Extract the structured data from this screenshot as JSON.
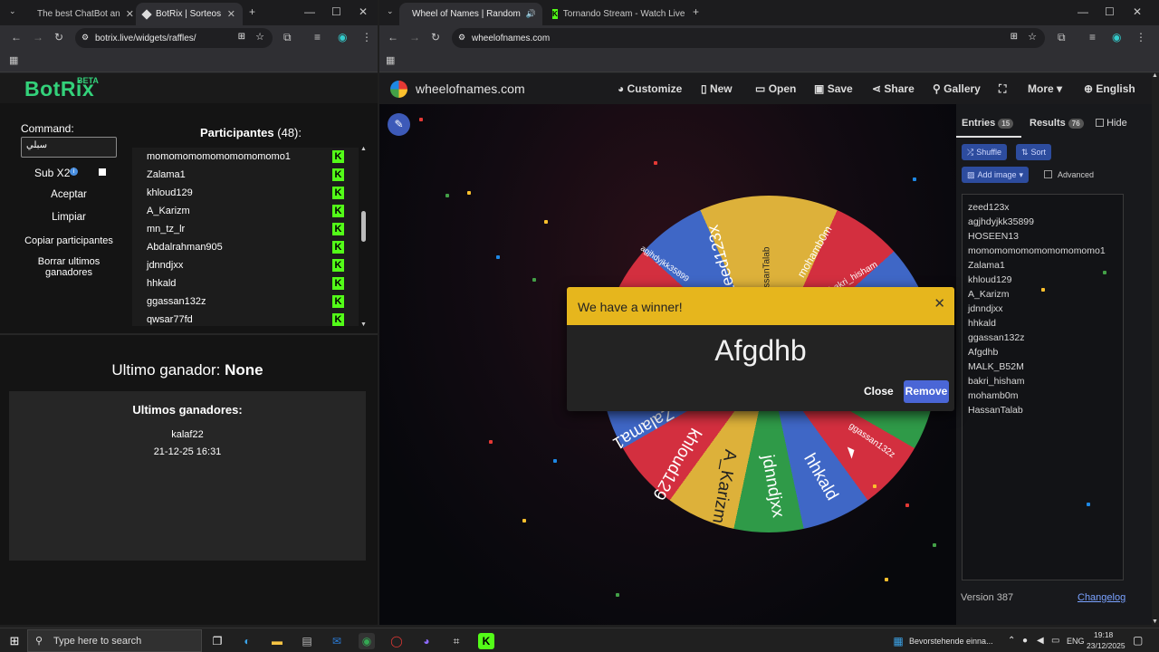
{
  "left_window": {
    "tabs": [
      {
        "label": "The best ChatBot an",
        "active": false
      },
      {
        "label": "BotRix | Sorteos",
        "active": true
      }
    ],
    "url": "botrix.live/widgets/raffles/",
    "app": {
      "logo": "BotRix",
      "beta": "BETA",
      "command_label": "Command:",
      "command_value": "سبلي",
      "sub_x2": "Sub X2",
      "buttons": [
        "Aceptar",
        "Limpiar",
        "Copiar participantes",
        "Borrar ultimos ganadores"
      ],
      "participants_title": "Participantes",
      "participants_count": "(48):",
      "participants": [
        "momomomomomomomomomo1",
        "Zalama1",
        "khloud129",
        "A_Karizm",
        "mn_tz_lr",
        "Abdalrahman905",
        "jdnndjxx",
        "hhkald",
        "ggassan132z",
        "qwsar77fd"
      ],
      "last_winner_label": "Ultimo ganador:",
      "last_winner_value": "None",
      "winners_title": "Ultimos ganadores:",
      "winners": [
        {
          "name": "kalaf22",
          "date": "21-12-25 16:31"
        }
      ]
    }
  },
  "right_window": {
    "tabs": [
      {
        "label": "Wheel of Names | Random",
        "active": true
      },
      {
        "label": "Tornando Stream - Watch Live",
        "active": false
      }
    ],
    "url": "wheelofnames.com",
    "app": {
      "logo": "wheelofnames.com",
      "nav": [
        "Customize",
        "New",
        "Open",
        "Save",
        "Share",
        "Gallery",
        "More",
        "English"
      ],
      "entries_tab": "Entries",
      "entries_count": "15",
      "results_tab": "Results",
      "results_count": "76",
      "hide": "Hide",
      "shuffle": "Shuffle",
      "sort": "Sort",
      "add_image": "Add image",
      "advanced": "Advanced",
      "entries": [
        "zeed123x",
        "agjhdyjkk35899",
        "HOSEEN13",
        "momomomomomomomomomo1",
        "Zalama1",
        "khloud129",
        "A_Karizm",
        "jdnndjxx",
        "hhkald",
        "ggassan132z",
        "Afgdhb",
        "MALK_B52M",
        "bakri_hisham",
        "mohamb0m",
        "HassanTalab"
      ],
      "version": "Version 387",
      "changelog": "Changelog",
      "wheel_labels": [
        "HassanTalab",
        "mohamb0m",
        "bakri_hisham",
        "zeed123x",
        "agjhdyjkk35899",
        "ggassan132z",
        "hhkald",
        "jdnndjxx",
        "A_Karizm",
        "khloud129",
        "Zalama1"
      ],
      "dialog": {
        "title": "We have a winner!",
        "winner": "Afgdhb",
        "close": "Close",
        "remove": "Remove"
      }
    }
  },
  "taskbar": {
    "search_placeholder": "Type here to search",
    "notification": "Bevorstehende einna...",
    "lang": "ENG",
    "time": "19:18",
    "date": "23/12/2025"
  },
  "colors": {
    "botrix_green": "#33d17a",
    "kick_green": "#53fc18",
    "dialog_yellow": "#e6b61d",
    "remove_blue": "#4a66d6"
  }
}
